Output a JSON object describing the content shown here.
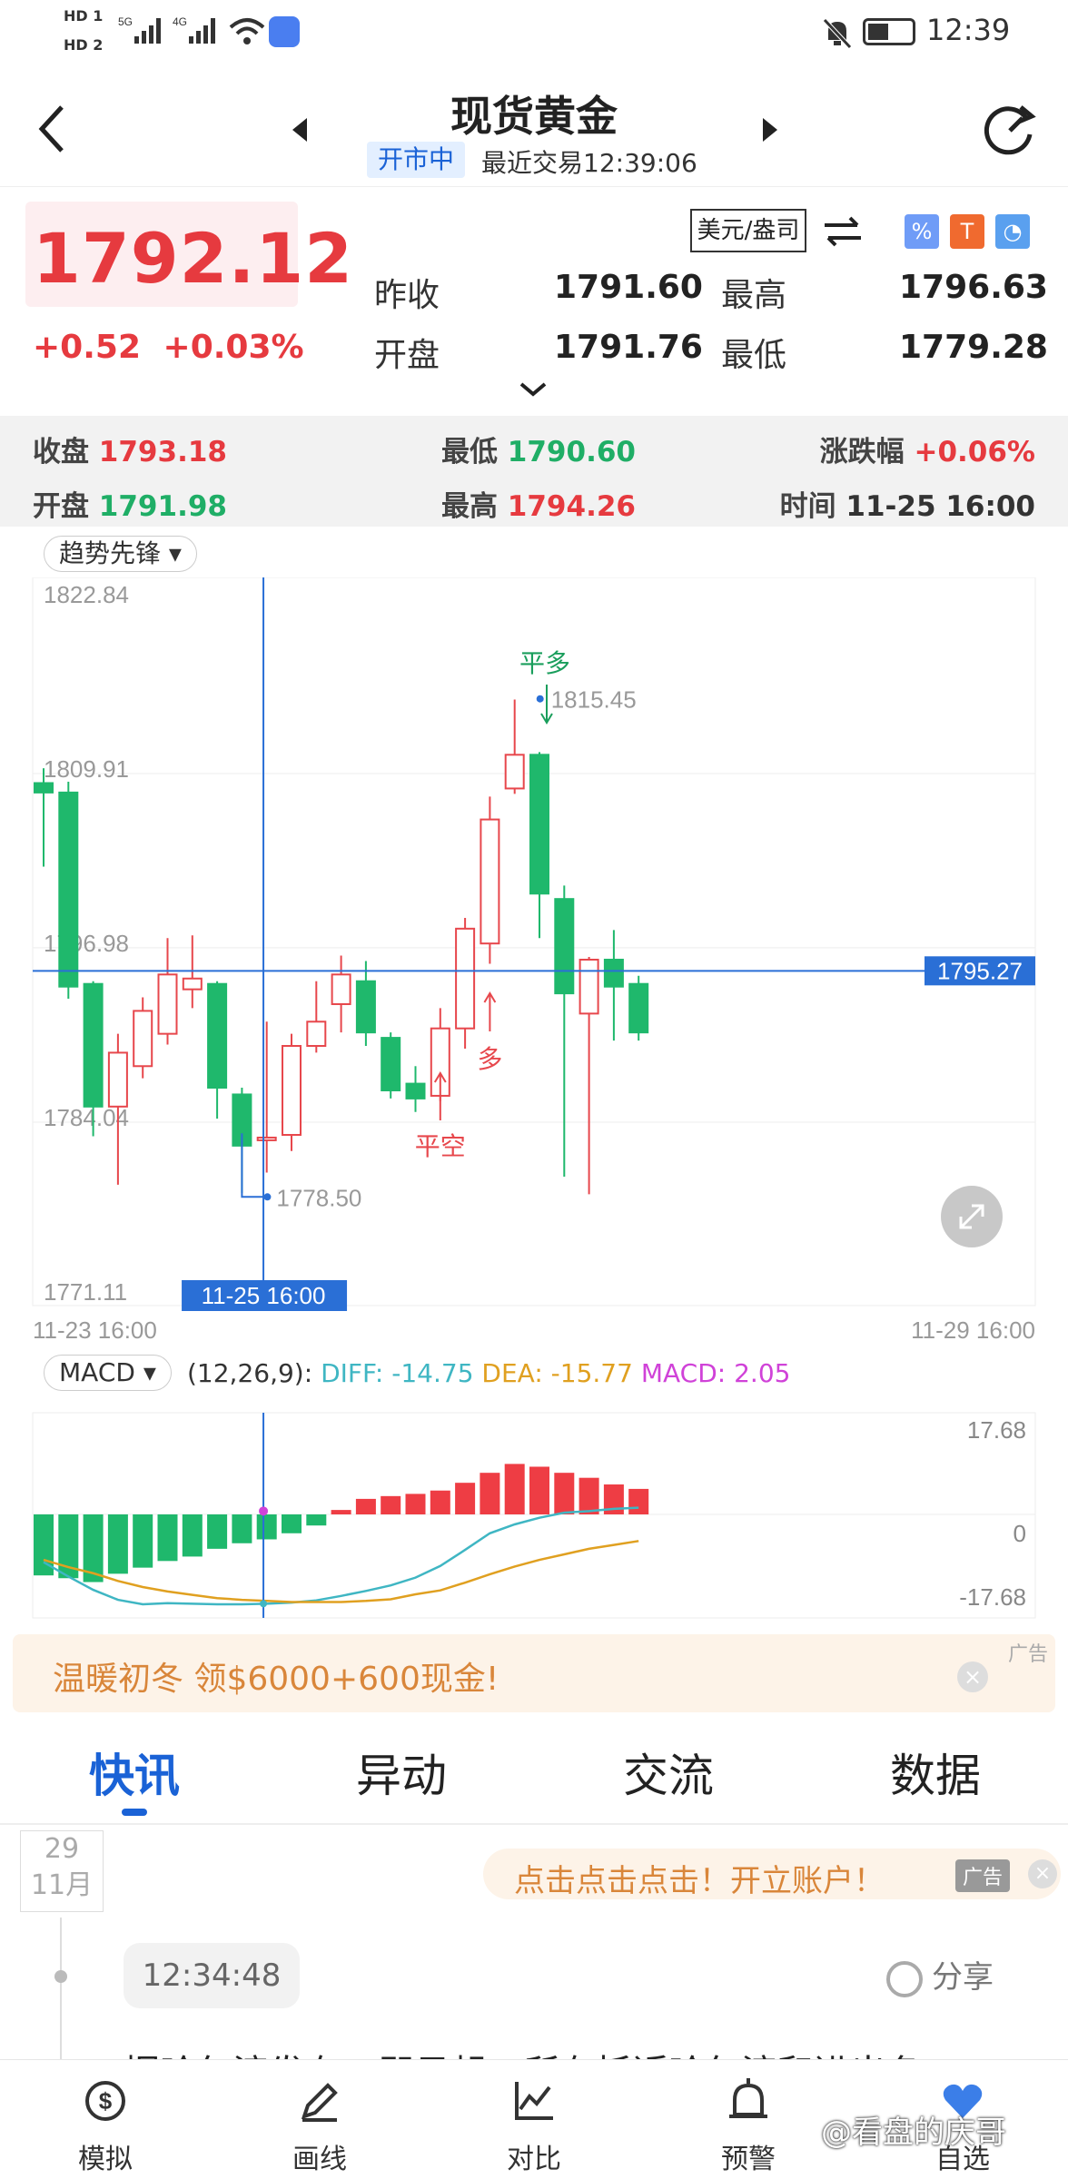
{
  "status_bar": {
    "left_icons": [
      "hd1-icon",
      "hd2-icon",
      "5g-signal-icon",
      "4g-signal-icon",
      "wifi-icon",
      "app-notification-icon"
    ],
    "signal_5g": "5G",
    "signal_4g": "4G",
    "hd1": "HD 1",
    "hd2": "HD 2",
    "time": "12:39"
  },
  "header": {
    "title": "现货黄金",
    "market_status": "开市中",
    "last_trade": "最近交易12:39:06"
  },
  "quote": {
    "price": "1792.12",
    "change": "+0.52",
    "change_pct": "+0.03%",
    "unit": "美元/盎司",
    "prev_close_label": "昨收",
    "prev_close": "1791.60",
    "high_label": "最高",
    "high": "1796.63",
    "open_label": "开盘",
    "open": "1791.76",
    "low_label": "最低",
    "low": "1779.28",
    "badge_colors": {
      "percent": "#5b8ef5",
      "fire": "#f06a2f",
      "pie": "#4a90e2"
    }
  },
  "info_band": {
    "close_label": "收盘",
    "close": "1793.18",
    "low_label": "最低",
    "low": "1790.60",
    "chg_label": "涨跌幅",
    "chg": "+0.06%",
    "open_label": "开盘",
    "open": "1791.98",
    "high_label": "最高",
    "high": "1794.26",
    "time_label": "时间",
    "time": "11-25 16:00"
  },
  "chart": {
    "indicator": "趋势先锋",
    "y_labels": [
      "1822.84",
      "1809.91",
      "1796.98",
      "1784.04",
      "1771.11"
    ],
    "x_start": "11-23 16:00",
    "x_end": "11-29 16:00",
    "cursor_time": "11-25 16:00",
    "cursor_price": "1795.27",
    "annotations": {
      "high_point": "1815.45",
      "low_point": "1778.50",
      "close_long": "平多",
      "long": "多",
      "close_short": "平空"
    }
  },
  "chart_data": [
    {
      "type": "candlestick",
      "title": "",
      "ylim": [
        1771.11,
        1822.84
      ],
      "x_range": [
        "11-23 16:00",
        "11-29 16:00"
      ],
      "candles": [
        {
          "o": 1809.2,
          "c": 1808.5,
          "h": 1810.3,
          "l": 1803.0
        },
        {
          "o": 1808.5,
          "c": 1794.1,
          "h": 1809.3,
          "l": 1793.2
        },
        {
          "o": 1794.3,
          "c": 1785.2,
          "h": 1794.5,
          "l": 1783.0
        },
        {
          "o": 1785.2,
          "c": 1789.2,
          "h": 1790.6,
          "l": 1779.4
        },
        {
          "o": 1788.2,
          "c": 1792.3,
          "h": 1793.3,
          "l": 1787.3
        },
        {
          "o": 1790.6,
          "c": 1795.0,
          "h": 1797.7,
          "l": 1789.8
        },
        {
          "o": 1793.9,
          "c": 1794.7,
          "h": 1797.9,
          "l": 1792.5
        },
        {
          "o": 1794.3,
          "c": 1786.6,
          "h": 1794.5,
          "l": 1784.3
        },
        {
          "o": 1786.1,
          "c": 1782.3,
          "h": 1786.6,
          "l": 1778.8
        },
        {
          "o": 1782.7,
          "c": 1782.9,
          "h": 1791.5,
          "l": 1780.3
        },
        {
          "o": 1783.1,
          "c": 1789.7,
          "h": 1790.6,
          "l": 1781.9
        },
        {
          "o": 1789.7,
          "c": 1791.5,
          "h": 1794.5,
          "l": 1789.2
        },
        {
          "o": 1792.8,
          "c": 1795.0,
          "h": 1796.4,
          "l": 1790.7
        },
        {
          "o": 1794.5,
          "c": 1790.7,
          "h": 1796.0,
          "l": 1789.7
        },
        {
          "o": 1790.3,
          "c": 1786.4,
          "h": 1790.7,
          "l": 1785.8
        },
        {
          "o": 1786.9,
          "c": 1785.8,
          "h": 1788.2,
          "l": 1784.8
        },
        {
          "o": 1786.0,
          "c": 1791.0,
          "h": 1792.5,
          "l": 1785.6
        },
        {
          "o": 1791.0,
          "c": 1798.4,
          "h": 1799.2,
          "l": 1789.5
        },
        {
          "o": 1797.3,
          "c": 1806.5,
          "h": 1808.2,
          "l": 1795.8
        },
        {
          "o": 1808.8,
          "c": 1811.3,
          "h": 1815.4,
          "l": 1808.4
        },
        {
          "o": 1811.3,
          "c": 1801.0,
          "h": 1811.5,
          "l": 1797.7
        },
        {
          "o": 1800.6,
          "c": 1793.6,
          "h": 1801.6,
          "l": 1780.0
        },
        {
          "o": 1792.1,
          "c": 1796.1,
          "h": 1796.3,
          "l": 1778.7
        },
        {
          "o": 1796.1,
          "c": 1794.1,
          "h": 1798.3,
          "l": 1790.1
        },
        {
          "o": 1794.3,
          "c": 1790.7,
          "h": 1794.9,
          "l": 1790.1
        }
      ]
    },
    {
      "type": "bar",
      "title": "MACD",
      "ylim": [
        -17.68,
        17.68
      ],
      "series": [
        {
          "name": "MACD",
          "values": [
            -11.0,
            -11.5,
            -12.2,
            -10.7,
            -9.6,
            -8.4,
            -7.6,
            -6.2,
            -5.2,
            -4.5,
            -3.4,
            -2.0,
            0.8,
            2.8,
            3.3,
            3.7,
            4.3,
            5.7,
            7.5,
            9.1,
            8.6,
            7.5,
            6.6,
            5.4,
            4.6
          ]
        },
        {
          "name": "DIFF",
          "values": [
            -8.6,
            -11.2,
            -13.6,
            -15.4,
            -16.2,
            -16.0,
            -16.1,
            -16.2,
            -16.2,
            -16.1,
            -15.9,
            -15.5,
            -14.7,
            -13.8,
            -12.8,
            -11.4,
            -9.3,
            -6.4,
            -3.4,
            -1.8,
            -0.6,
            0.3,
            0.6,
            1.0,
            1.2
          ]
        },
        {
          "name": "DEA",
          "values": [
            -8.2,
            -9.5,
            -10.6,
            -12.0,
            -13.1,
            -13.9,
            -14.5,
            -15.1,
            -15.4,
            -15.6,
            -15.8,
            -15.8,
            -15.8,
            -15.6,
            -15.3,
            -14.4,
            -13.7,
            -12.3,
            -10.8,
            -9.4,
            -8.2,
            -7.2,
            -6.2,
            -5.5,
            -4.8
          ]
        }
      ]
    }
  ],
  "macd": {
    "indicator": "MACD",
    "params": "(12,26,9):",
    "diff_text": "DIFF: -14.75",
    "dea_text": "DEA: -15.77",
    "macd_text": "MACD: 2.05",
    "y_top": "17.68",
    "y_mid": "0",
    "y_bot": "-17.68",
    "colors": {
      "diff": "#3fb6c3",
      "dea": "#e0a020",
      "macd": "#d042d8",
      "bar_up": "#ee3d44",
      "bar_down": "#1fb86c"
    }
  },
  "ad_banner": {
    "text": "温暖初冬 领$6000+600现金!",
    "tag": "广告"
  },
  "tabs": [
    {
      "label": "快讯"
    },
    {
      "label": "异动"
    },
    {
      "label": "交流"
    },
    {
      "label": "数据"
    }
  ],
  "feed": {
    "day": "29",
    "month": "11月",
    "promo": "点击点击点击！开立账户！",
    "promo_tag": "广告",
    "timestamp": "12:34:48",
    "share": "分享",
    "headline": "据哈尔滨发布：即日起，所有抵近哈尔滨和进出冬"
  },
  "bottom_nav": [
    {
      "label": "模拟",
      "icon": "dollar-cycle-icon"
    },
    {
      "label": "画线",
      "icon": "pen-icon"
    },
    {
      "label": "对比",
      "icon": "chart-compare-icon"
    },
    {
      "label": "预警",
      "icon": "bell-alarm-icon"
    },
    {
      "label": "自选",
      "icon": "heart-icon"
    }
  ],
  "watermark": "@看盘的庆哥"
}
